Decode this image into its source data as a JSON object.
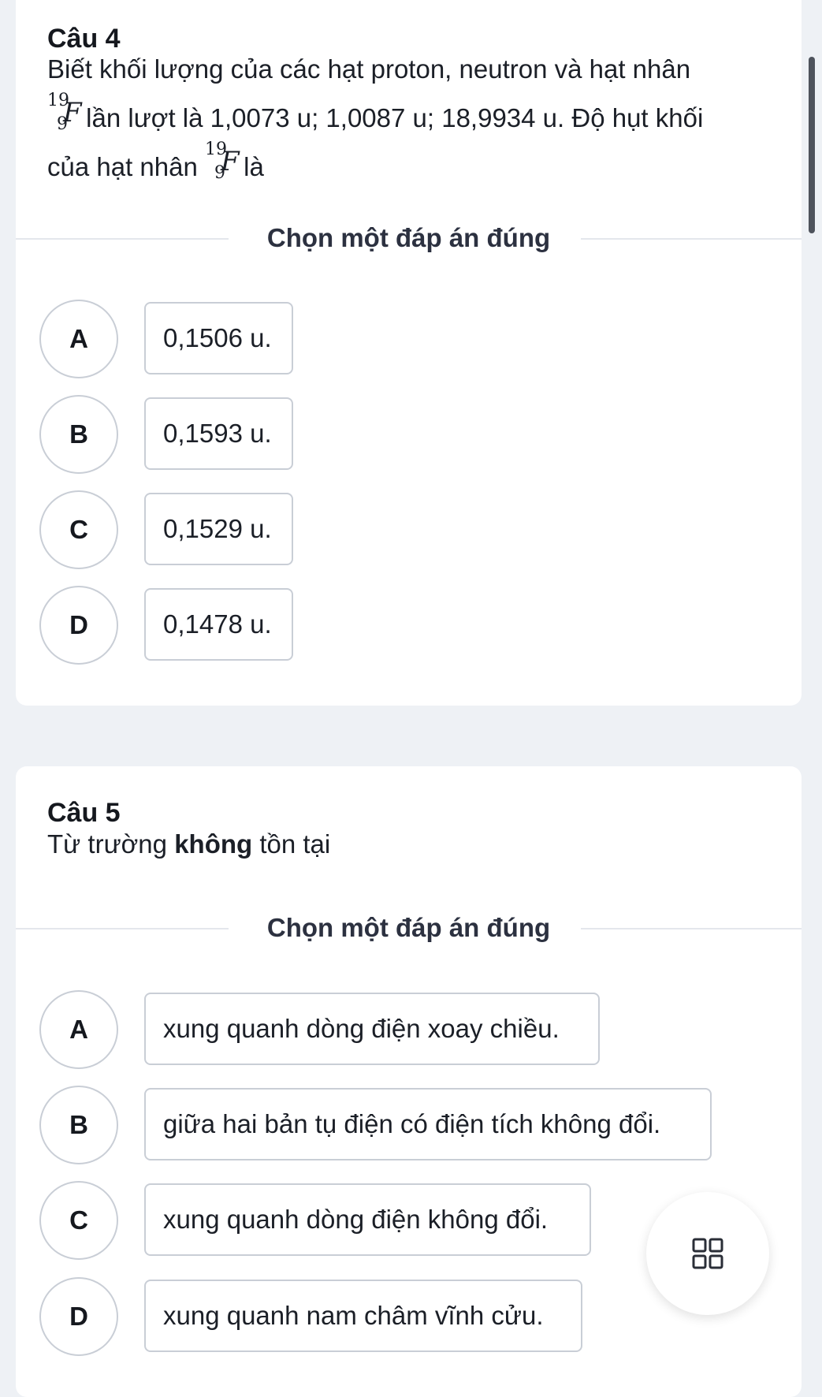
{
  "questions": [
    {
      "title": "Câu 4",
      "text_line1": "Biết khối lượng của các hạt proton, neutron và hạt nhân",
      "nuclide": {
        "mass_number": "19",
        "atomic_number": "9",
        "symbol": "F"
      },
      "text_line2_after": " lần lượt là 1,0073 u; 1,0087 u; 18,9934 u. Độ hụt khối",
      "text_line3_before": "của hạt nhân ",
      "text_line3_after": " là",
      "instruction": "Chọn một đáp án đúng",
      "options": [
        {
          "letter": "A",
          "text": "0,1506 u."
        },
        {
          "letter": "B",
          "text": "0,1593 u."
        },
        {
          "letter": "C",
          "text": "0,1529 u."
        },
        {
          "letter": "D",
          "text": "0,1478 u."
        }
      ]
    },
    {
      "title": "Câu 5",
      "text_before_bold": "Từ trường ",
      "text_bold": "không",
      "text_after_bold": " tồn tại",
      "instruction": "Chọn một đáp án đúng",
      "options": [
        {
          "letter": "A",
          "text": "xung quanh dòng điện xoay chiều."
        },
        {
          "letter": "B",
          "text": "giữa hai bản tụ điện có điện tích không đổi."
        },
        {
          "letter": "C",
          "text": "xung quanh dòng điện không đổi."
        },
        {
          "letter": "D",
          "text": "xung quanh nam châm vĩnh cửu."
        }
      ]
    }
  ],
  "fab_icon": "grid-icon",
  "colors": {
    "background": "#eef1f5",
    "card": "#ffffff",
    "border": "#c9ced6",
    "text": "#1b1f27"
  }
}
